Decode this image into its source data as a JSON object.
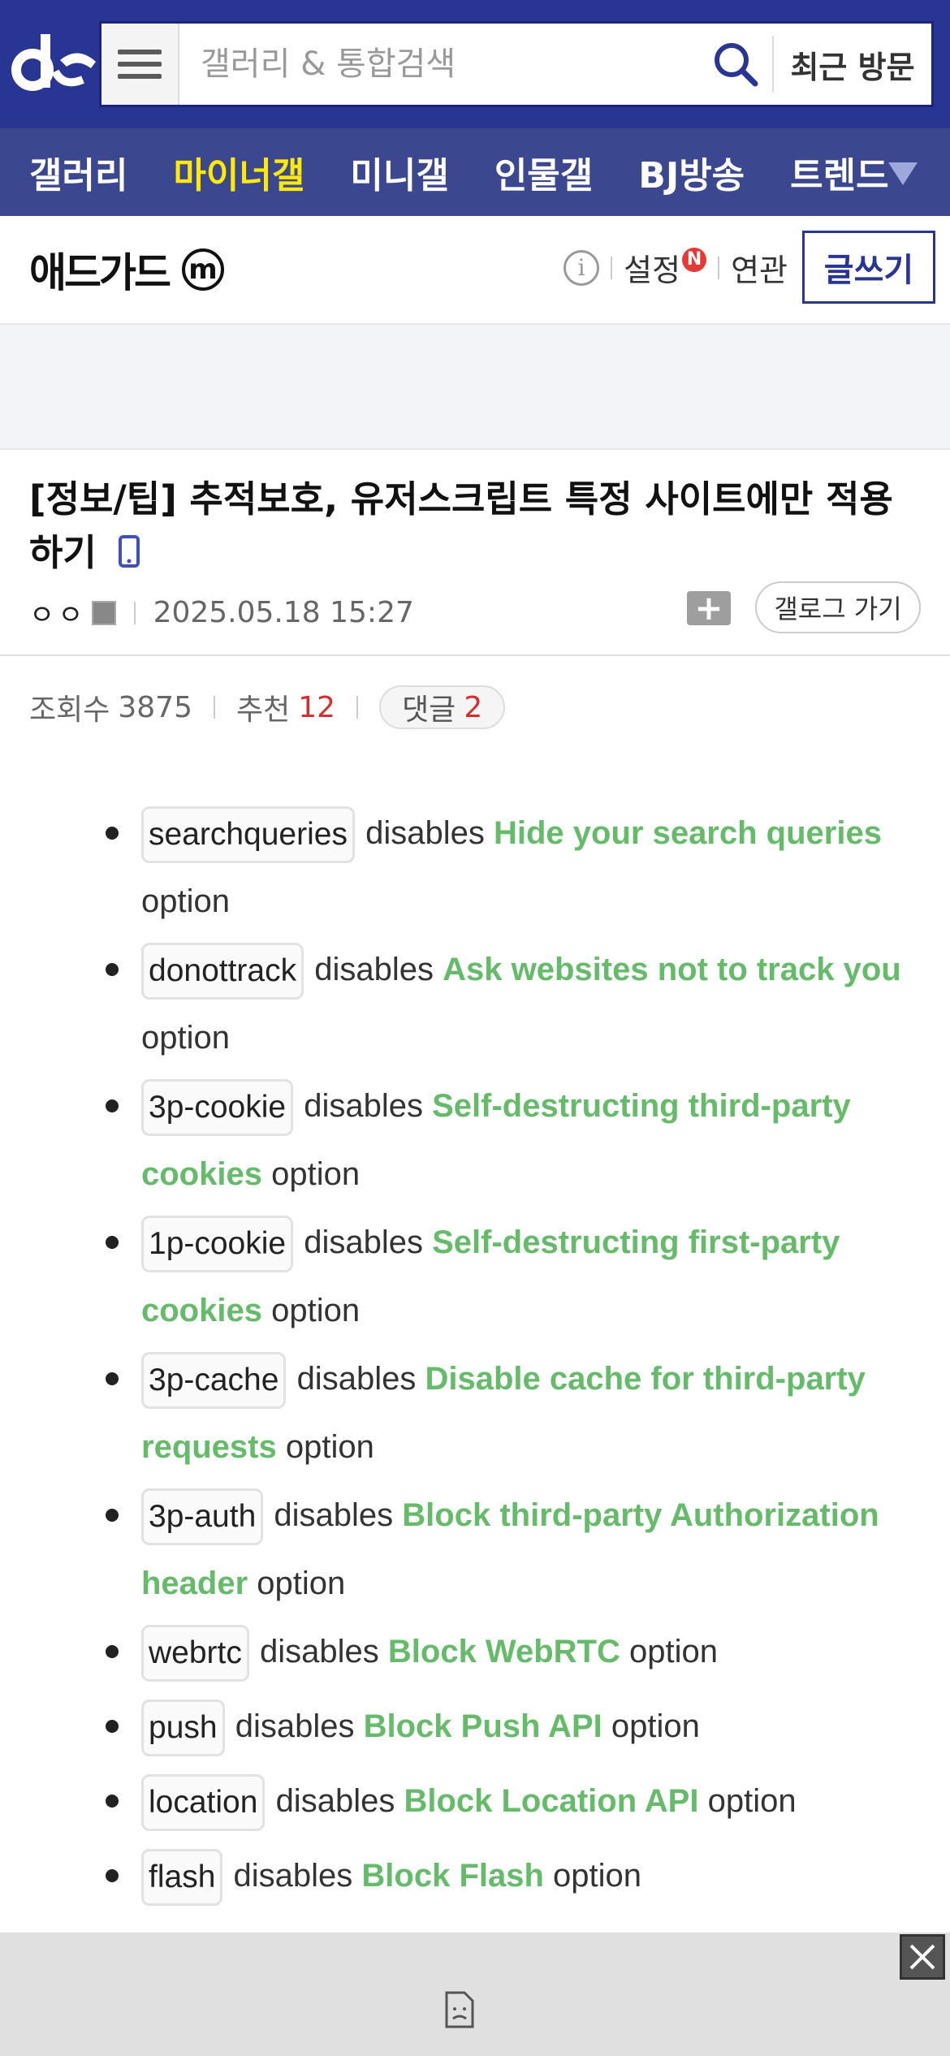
{
  "header": {
    "search_placeholder": "갤러리 & 통합검색",
    "recent_label": "최근 방문"
  },
  "nav": {
    "items": [
      "갤러리",
      "마이너갤",
      "미니갤",
      "인물갤",
      "BJ방송",
      "트렌드"
    ],
    "active_index": 1
  },
  "gallery": {
    "title": "애드가드",
    "badge": "m",
    "settings_label": "설정",
    "settings_badge": "N",
    "related_label": "연관",
    "write_label": "글쓰기"
  },
  "post": {
    "title": "[정보/팁] 추적보호, 유저스크립트 특정 사이트에만 적용하기",
    "author": "ㅇㅇ",
    "datetime": "2025.05.18 15:27",
    "gallog_label": "갤로그 가기",
    "views_label": "조회수",
    "views": "3875",
    "recommend_label": "추천",
    "recommend": "12",
    "comments_label": "댓글",
    "comments": "2"
  },
  "content": {
    "items": [
      {
        "code": "searchqueries",
        "pre": "disables",
        "hl": "Hide your search queries",
        "post": "option"
      },
      {
        "code": "donottrack",
        "pre": "disables",
        "hl": "Ask websites not to track you",
        "post": "option"
      },
      {
        "code": "3p-cookie",
        "pre": "disables",
        "hl": "Self-destructing third-party cookies",
        "post": "option"
      },
      {
        "code": "1p-cookie",
        "pre": "disables",
        "hl": "Self-destructing first-party cookies",
        "post": "option"
      },
      {
        "code": "3p-cache",
        "pre": "disables",
        "hl": "Disable cache for third-party requests",
        "post": "option"
      },
      {
        "code": "3p-auth",
        "pre": "disables",
        "hl": "Block third-party Authorization header",
        "post": "option"
      },
      {
        "code": "webrtc",
        "pre": "disables",
        "hl": "Block WebRTC",
        "post": "option"
      },
      {
        "code": "push",
        "pre": "disables",
        "hl": "Block Push API",
        "post": "option"
      },
      {
        "code": "location",
        "pre": "disables",
        "hl": "Block Location API",
        "post": "option"
      },
      {
        "code": "flash",
        "pre": "disables",
        "hl": "Block Flash",
        "post": "option"
      }
    ]
  },
  "colors": {
    "header_bg": "#283593",
    "nav_bg": "#3b4890",
    "nav_active": "#ffea00",
    "highlight_green": "#66bb6a",
    "count_red": "#d32f2f"
  }
}
